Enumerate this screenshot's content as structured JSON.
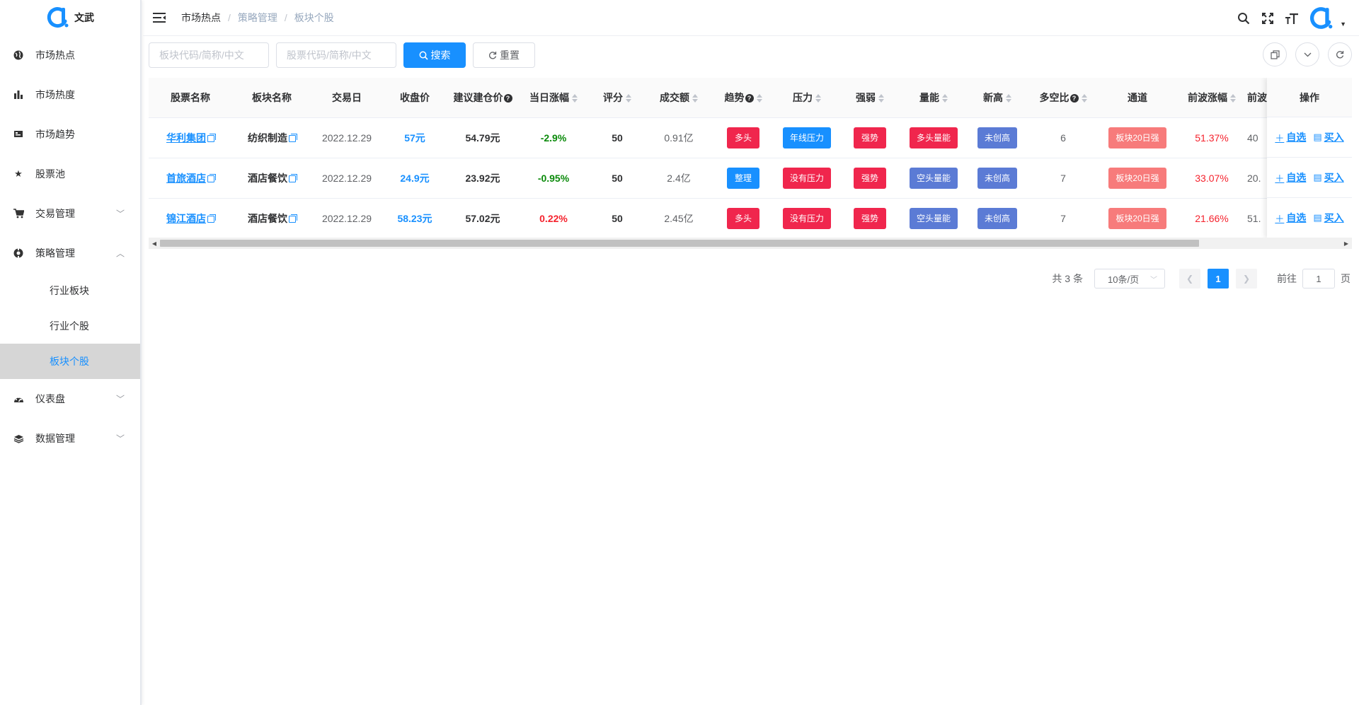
{
  "brand": {
    "name": "文武",
    "color": "#1890ff"
  },
  "sidebar": {
    "items": [
      {
        "label": "市场热点",
        "icon": "globe-icon"
      },
      {
        "label": "市场热度",
        "icon": "bar-chart-icon"
      },
      {
        "label": "市场趋势",
        "icon": "monitor-icon"
      },
      {
        "label": "股票池",
        "icon": "star-icon"
      },
      {
        "label": "交易管理",
        "icon": "cart-icon",
        "expandable": true
      },
      {
        "label": "策略管理",
        "icon": "strategy-icon",
        "expanded": true,
        "children": [
          "行业板块",
          "行业个股",
          "板块个股"
        ],
        "active_child": "板块个股"
      },
      {
        "label": "仪表盘",
        "icon": "dashboard-icon",
        "expandable": true
      },
      {
        "label": "数据管理",
        "icon": "layers-icon",
        "expandable": true
      }
    ]
  },
  "header": {
    "breadcrumb": [
      "市场热点",
      "策略管理",
      "板块个股"
    ],
    "sep": "/",
    "icons": [
      "search-icon",
      "fullscreen-icon",
      "font-size-icon"
    ]
  },
  "toolbar": {
    "sector_placeholder": "板块代码/简称/中文",
    "stock_placeholder": "股票代码/简称/中文",
    "search_label": "搜索",
    "reset_label": "重置"
  },
  "table": {
    "columns": [
      "股票名称",
      "板块名称",
      "交易日",
      "收盘价",
      "建议建仓价",
      "当日涨幅",
      "评分",
      "成交额",
      "趋势",
      "压力",
      "强弱",
      "量能",
      "新高",
      "多空比",
      "通道",
      "前波涨幅",
      "前波",
      "操作"
    ],
    "rows": [
      {
        "name": "华利集团",
        "sector": "纺织制造",
        "date": "2022.12.29",
        "close": "57元",
        "suggest": "54.79元",
        "change": "-2.9%",
        "change_dir": "down",
        "score": "50",
        "amount": "0.91亿",
        "trend": {
          "text": "多头",
          "color": "#f0264d"
        },
        "pressure": {
          "text": "年线压力",
          "color": "#1890ff"
        },
        "strength": {
          "text": "强势",
          "color": "#f0264d"
        },
        "volume": {
          "text": "多头量能",
          "color": "#f0264d"
        },
        "high": {
          "text": "未创高",
          "color": "#5b7bd5"
        },
        "ratio": "6",
        "channel": {
          "text": "板块20日强",
          "color": "#f77b7b"
        },
        "prev_gain": "51.37%",
        "prev": "40"
      },
      {
        "name": "首旅酒店",
        "sector": "酒店餐饮",
        "date": "2022.12.29",
        "close": "24.9元",
        "suggest": "23.92元",
        "change": "-0.95%",
        "change_dir": "down",
        "score": "50",
        "amount": "2.4亿",
        "trend": {
          "text": "整理",
          "color": "#1890ff"
        },
        "pressure": {
          "text": "没有压力",
          "color": "#f0264d"
        },
        "strength": {
          "text": "强势",
          "color": "#f0264d"
        },
        "volume": {
          "text": "空头量能",
          "color": "#5b7bd5"
        },
        "high": {
          "text": "未创高",
          "color": "#5b7bd5"
        },
        "ratio": "7",
        "channel": {
          "text": "板块20日强",
          "color": "#f77b7b"
        },
        "prev_gain": "33.07%",
        "prev": "20."
      },
      {
        "name": "锦江酒店",
        "sector": "酒店餐饮",
        "date": "2022.12.29",
        "close": "58.23元",
        "suggest": "57.02元",
        "change": "0.22%",
        "change_dir": "up",
        "score": "50",
        "amount": "2.45亿",
        "trend": {
          "text": "多头",
          "color": "#f0264d"
        },
        "pressure": {
          "text": "没有压力",
          "color": "#f0264d"
        },
        "strength": {
          "text": "强势",
          "color": "#f0264d"
        },
        "volume": {
          "text": "空头量能",
          "color": "#5b7bd5"
        },
        "high": {
          "text": "未创高",
          "color": "#5b7bd5"
        },
        "ratio": "7",
        "channel": {
          "text": "板块20日强",
          "color": "#f77b7b"
        },
        "prev_gain": "21.66%",
        "prev": "51."
      }
    ],
    "ops": {
      "watch_label": "自选",
      "buy_label": "买入"
    }
  },
  "pagination": {
    "total_label": "共 3 条",
    "page_size_label": "10条/页",
    "current_page": "1",
    "goto_label": "前往",
    "goto_value": "1",
    "page_suffix": "页"
  }
}
